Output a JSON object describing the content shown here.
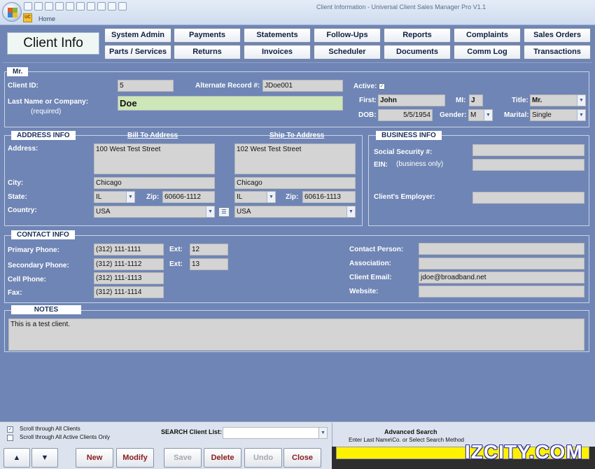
{
  "window": {
    "title": "Client Information - Universal Client Sales Manager Pro V1.1",
    "home_tab": "Home",
    "app_badge": "UC"
  },
  "header": {
    "title": "Client Info"
  },
  "nav": {
    "row1": [
      "System Admin",
      "Payments",
      "Statements",
      "Follow-Ups",
      "Reports",
      "Complaints",
      "Sales Orders"
    ],
    "row2": [
      "Parts / Services",
      "Returns",
      "Invoices",
      "Scheduler",
      "Documents",
      "Comm Log",
      "Transactions"
    ]
  },
  "name_panel": {
    "title": "Mr.",
    "client_id_label": "Client ID:",
    "client_id": "5",
    "alt_record_label": "Alternate Record #:",
    "alt_record": "JDoe001",
    "active_label": "Active:",
    "active_checked": true,
    "last_name_label": "Last Name or Company:",
    "required_note": "(required)",
    "last_name": "Doe",
    "first_label": "First:",
    "first": "John",
    "mi_label": "MI:",
    "mi": "J",
    "title_label": "Title:",
    "dob_label": "DOB:",
    "dob": "5/5/1954",
    "gender_label": "Gender:",
    "gender": "M",
    "marital_label": "Marital:",
    "marital": "Single"
  },
  "address_panel": {
    "title": "ADDRESS INFO",
    "bill_to": "Bill To Address",
    "ship_to": "Ship To Address",
    "address_label": "Address:",
    "city_label": "City:",
    "state_label": "State:",
    "zip_label": "Zip:",
    "country_label": "Country:",
    "bill": {
      "address": "100 West Test Street",
      "city": "Chicago",
      "state": "IL",
      "zip": "60606-1112",
      "country": "USA"
    },
    "ship": {
      "address": "102 West Test Street",
      "city": "Chicago",
      "state": "IL",
      "zip": "60616-1113",
      "country": "USA"
    }
  },
  "business_panel": {
    "title": "BUSINESS INFO",
    "ssn_label": "Social Security #:",
    "ein_label": "EIN:",
    "ein_note": "(business only)",
    "employer_label": "Client's Employer:",
    "ssn": "",
    "ein": "",
    "employer": ""
  },
  "contact_panel": {
    "title": "CONTACT INFO",
    "primary_label": "Primary Phone:",
    "primary": "(312) 111-1111",
    "secondary_label": "Secondary Phone:",
    "secondary": "(312) 111-1112",
    "cell_label": "Cell Phone:",
    "cell": "(312) 111-1113",
    "fax_label": "Fax:",
    "fax": "(312) 111-1114",
    "ext_label": "Ext:",
    "ext1": "12",
    "ext2": "13",
    "contact_person_label": "Contact Person:",
    "association_label": "Association:",
    "email_label": "Client Email:",
    "email": "jdoe@broadband.net",
    "website_label": "Website:"
  },
  "notes_panel": {
    "title": "NOTES",
    "text": "This is a test client."
  },
  "bottom": {
    "scroll_all": "Scroll through All Clients",
    "scroll_active": "Scroll through All Active Clients Only",
    "search_label": "SEARCH Client List:",
    "buttons": {
      "new": "New",
      "modify": "Modify",
      "save": "Save",
      "delete": "Delete",
      "undo": "Undo",
      "close": "Close"
    },
    "advanced_title": "Advanced Search",
    "advanced_hint": "Enter Last Name\\Co. or Select Search Method",
    "watermark": "IZCITY.COM"
  }
}
